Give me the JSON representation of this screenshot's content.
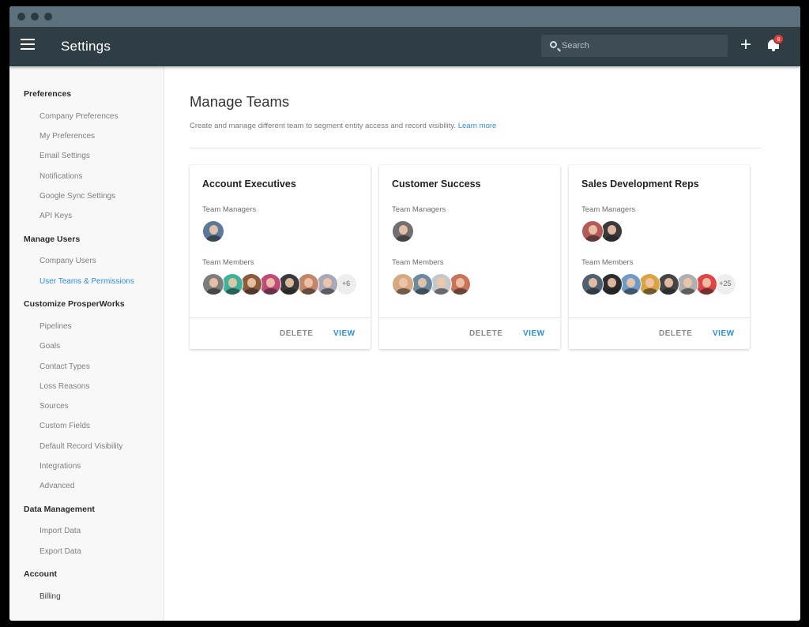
{
  "header": {
    "title": "Settings",
    "search_placeholder": "Search",
    "add_label": "+",
    "notification_count": "8"
  },
  "sidebar": {
    "sections": [
      {
        "title": "Preferences",
        "items": [
          "Company Preferences",
          "My Preferences",
          "Email Settings",
          "Notifications",
          "Google Sync Settings",
          "API Keys"
        ]
      },
      {
        "title": "Manage Users",
        "items": [
          "Company Users",
          "User Teams & Permissions"
        ]
      },
      {
        "title": "Customize ProsperWorks",
        "items": [
          "Pipelines",
          "Goals",
          "Contact Types",
          "Loss Reasons",
          "Sources",
          "Custom Fields",
          "Default Record Visibility",
          "Integrations",
          "Advanced"
        ]
      },
      {
        "title": "Data Management",
        "items": [
          "Import Data",
          "Export Data"
        ]
      },
      {
        "title": "Account",
        "items": [
          "Billing"
        ]
      }
    ],
    "active_item": "User Teams & Permissions"
  },
  "main": {
    "title": "Manage Teams",
    "description": "Create and manage different team to segment entity access and record visibility.",
    "learn_more": "Learn more",
    "teams": [
      {
        "name": "Account Executives",
        "managers_label": "Team Managers",
        "members_label": "Team Members",
        "manager_colors": [
          "#5b7a9a"
        ],
        "member_colors": [
          "#7d7d7d",
          "#3fb29c",
          "#8b5a3c",
          "#c04a7a",
          "#3b3b3b",
          "#c2876a",
          "#a9a9b8"
        ],
        "more_members": "+6",
        "delete_label": "DELETE",
        "view_label": "VIEW"
      },
      {
        "name": "Customer Success",
        "managers_label": "Team Managers",
        "members_label": "Team Members",
        "manager_colors": [
          "#707070"
        ],
        "member_colors": [
          "#d6a982",
          "#6a8aa2",
          "#c8c8c8",
          "#c8735a"
        ],
        "more_members": "",
        "delete_label": "DELETE",
        "view_label": "VIEW"
      },
      {
        "name": "Sales Development Reps",
        "managers_label": "Team Managers",
        "members_label": "Team Members",
        "manager_colors": [
          "#b45a5a",
          "#3a3a3a"
        ],
        "member_colors": [
          "#506070",
          "#2d2d2d",
          "#6d9ac8",
          "#d9a441",
          "#454545",
          "#b0b0b0",
          "#e04545"
        ],
        "more_members": "+25",
        "delete_label": "DELETE",
        "view_label": "VIEW"
      }
    ]
  },
  "colors": {
    "accent": "#2d8ee0",
    "appbar": "#2f3d45",
    "titlebar": "#5d717d",
    "badge": "#e23c34"
  }
}
